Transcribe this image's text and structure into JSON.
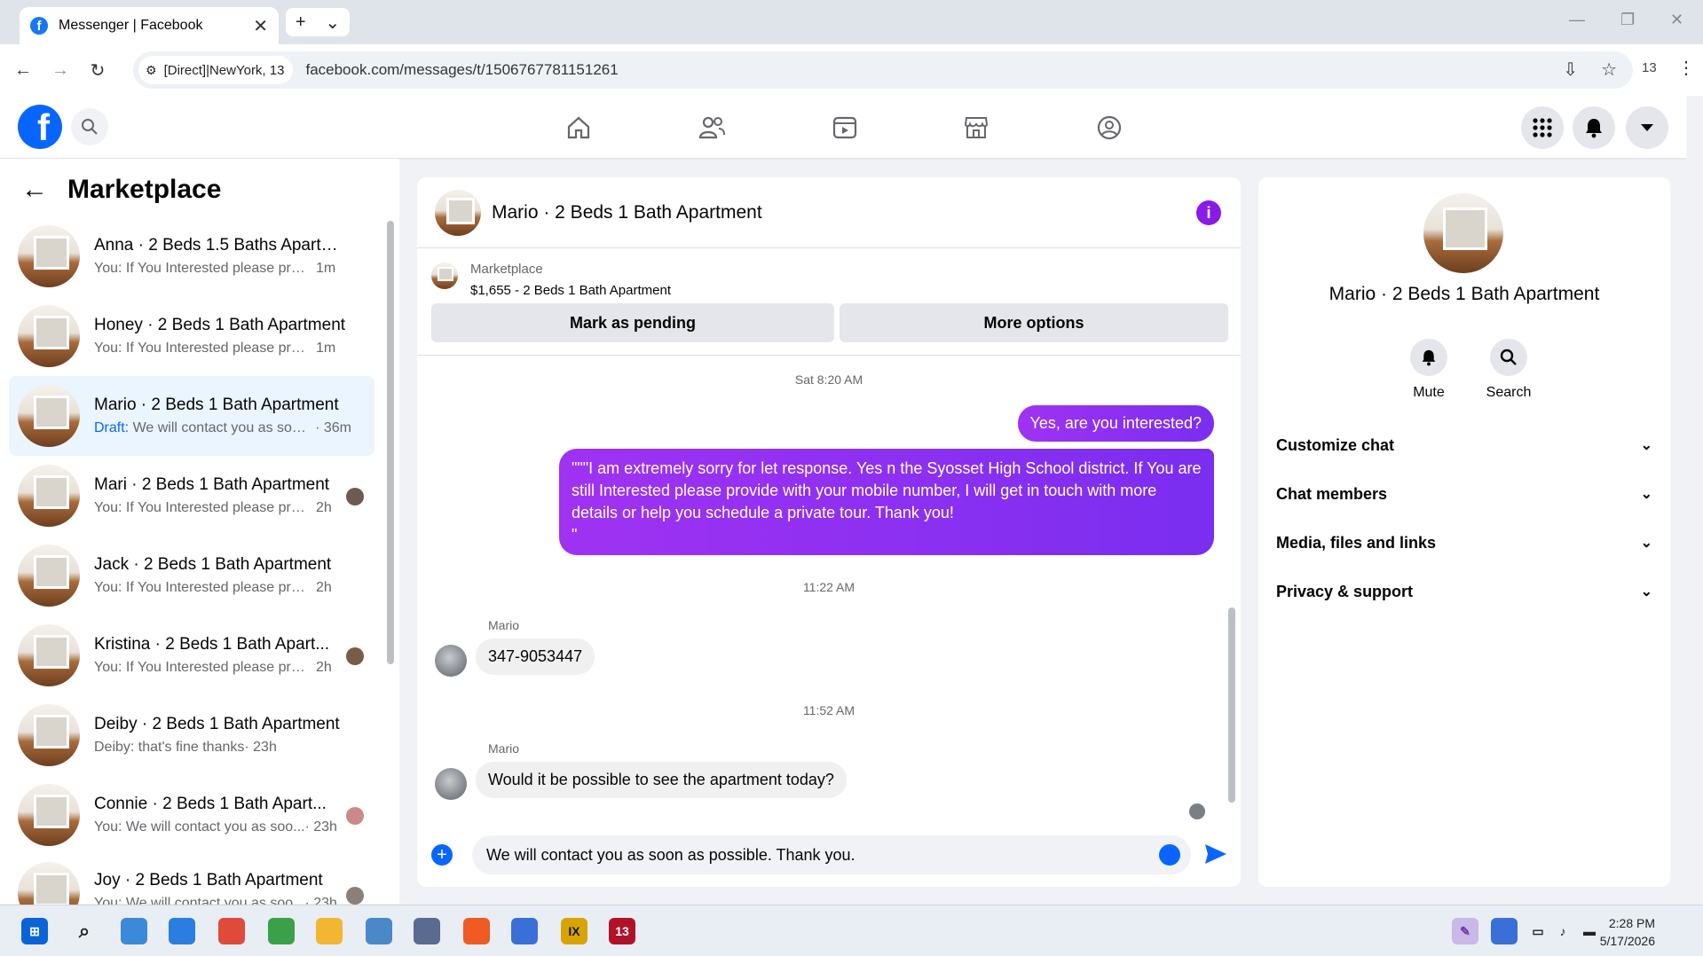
{
  "browser": {
    "tab_title": "Messenger | Facebook",
    "site_chip": "[Direct]|NewYork, 13",
    "url": "facebook.com/messages/t/1506767781151261",
    "ext_count": "13"
  },
  "sidebar": {
    "title": "Marketplace",
    "conversations": [
      {
        "name": "Anna · 2 Beds 1.5 Baths Apartme...",
        "prefix": "",
        "snippet": "You: If You Interested please provi...",
        "time": "1m"
      },
      {
        "name": "Honey · 2 Beds 1 Bath Apartment",
        "prefix": "",
        "snippet": "You: If You Interested please provi...",
        "time": "1m"
      },
      {
        "name": "Mario · 2 Beds 1 Bath Apartment",
        "prefix": "Draft:",
        "snippet": " We will contact you as soo...",
        "time": "· 36m"
      },
      {
        "name": "Mari · 2 Beds 1 Bath Apartment",
        "prefix": "",
        "snippet": "You: If You Interested please pro...",
        "time": "2h"
      },
      {
        "name": "Jack · 2 Beds 1 Bath Apartment",
        "prefix": "",
        "snippet": "You: If You Interested please provid...",
        "time": "2h"
      },
      {
        "name": "Kristina · 2 Beds 1 Bath Apart...",
        "prefix": "",
        "snippet": "You: If You Interested please pro...",
        "time": "2h"
      },
      {
        "name": "Deiby · 2 Beds 1 Bath Apartment",
        "prefix": "",
        "snippet": "Deiby: that's fine thanks",
        "time": "· 23h"
      },
      {
        "name": "Connie · 2 Beds 1 Bath Apart...",
        "prefix": "",
        "snippet": "You: We will contact you as soo...",
        "time": "· 23h"
      },
      {
        "name": "Joy · 2 Beds 1 Bath Apartment",
        "prefix": "",
        "snippet": "You: We will contact you as soo...",
        "time": "· 23h"
      }
    ]
  },
  "chat": {
    "title": "Mario · 2 Beds 1 Bath Apartment",
    "marketplace_label": "Marketplace",
    "listing": "$1,655 - 2 Beds 1 Bath Apartment",
    "mark_pending": "Mark as pending",
    "more_options": "More options",
    "ts1": "Sat 8:20 AM",
    "out1": "Yes, are you interested?",
    "out2": "\"\"\"I am extremely sorry for let response. Yes n the Syosset High School district. If You are still Interested please provide with your mobile number, I will get in touch with more details or help you schedule a private tour. Thank you!\n\"",
    "ts2": "11:22 AM",
    "sender1": "Mario",
    "in1": "347-9053447",
    "ts3": "11:52 AM",
    "sender2": "Mario",
    "in2": "Would it be possible to see the apartment today?",
    "draft": "We will contact you as soon as possible. Thank you."
  },
  "details": {
    "name": "Mario · 2 Beds 1 Bath Apartment",
    "mute": "Mute",
    "search": "Search",
    "sections": [
      "Customize chat",
      "Chat members",
      "Media, files and links",
      "Privacy & support"
    ]
  },
  "taskbar": {
    "time": "2:28 PM",
    "date": "5/17/2026",
    "badge": "13"
  },
  "colors": {
    "accent": "#0866ff",
    "bubble_out": "#8a2ef2",
    "info": "#8a1ae8"
  }
}
